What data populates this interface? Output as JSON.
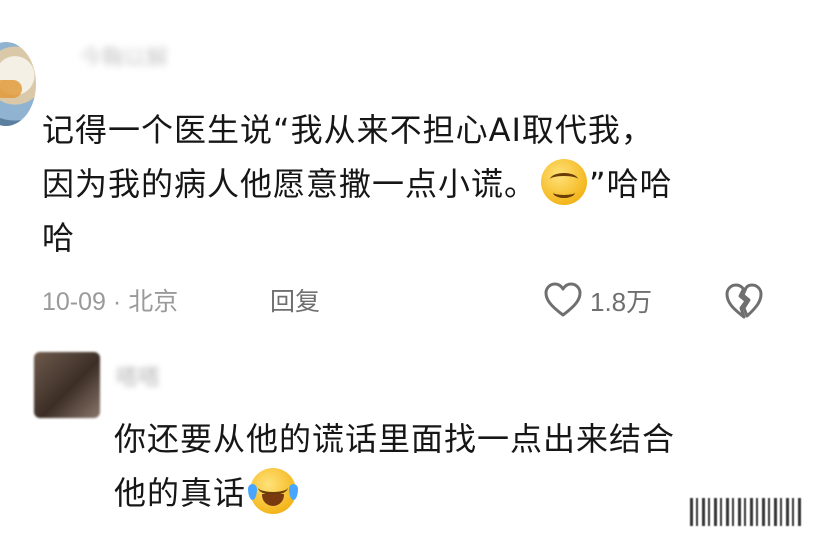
{
  "comment1": {
    "author": "今鞠以解",
    "text_line1": "记得一个医生说“我从来不担心AI取代我，",
    "text_line2": "因为我的病人他愿意撒一点小谎。",
    "text_line2_after": "”哈哈",
    "text_line3": "哈",
    "date": "10-09",
    "separator": "·",
    "location": "北京",
    "reply_label": "回复",
    "like_count": "1.8万"
  },
  "comment2": {
    "author": "嗒嗒",
    "text_line1": "你还要从他的谎话里面找一点出来结合",
    "text_line2": "他的真话"
  },
  "icons": {
    "like": "heart-outline-icon",
    "dislike": "broken-heart-icon",
    "emoji1": "smirk-emoji",
    "emoji2": "tears-of-joy-emoji"
  },
  "colors": {
    "text": "#161616",
    "meta": "#9a9a9a",
    "action": "#6f6f6f"
  }
}
